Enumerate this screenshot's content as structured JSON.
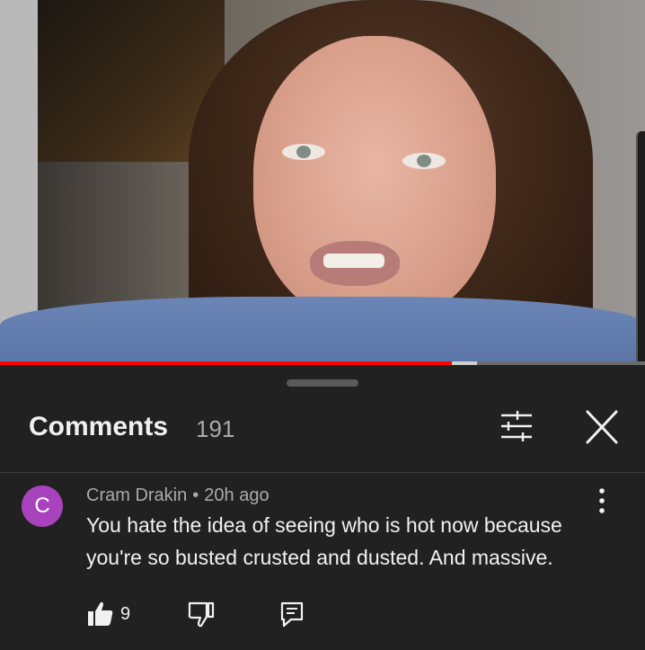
{
  "player": {
    "progress_played": 0.7,
    "progress_buffered_end": 0.74
  },
  "comments_panel": {
    "title": "Comments",
    "count": "191",
    "filter_icon": "sliders-icon",
    "close_icon": "close-icon"
  },
  "comment": {
    "avatar_letter": "C",
    "avatar_color": "#a942bd",
    "author": "Cram Drakin",
    "separator": "•",
    "time": "20h ago",
    "text": "You hate the idea of seeing who is hot now because you're so busted crusted and dusted. And massive.",
    "like_count": "9",
    "icons": {
      "like": "thumbs-up-icon",
      "dislike": "thumbs-down-icon",
      "reply": "reply-icon",
      "more": "more-vert-icon"
    }
  },
  "colors": {
    "background": "#212121",
    "text": "#f1f1f1",
    "muted": "#aaaaaa",
    "progress": "#ff0000"
  }
}
